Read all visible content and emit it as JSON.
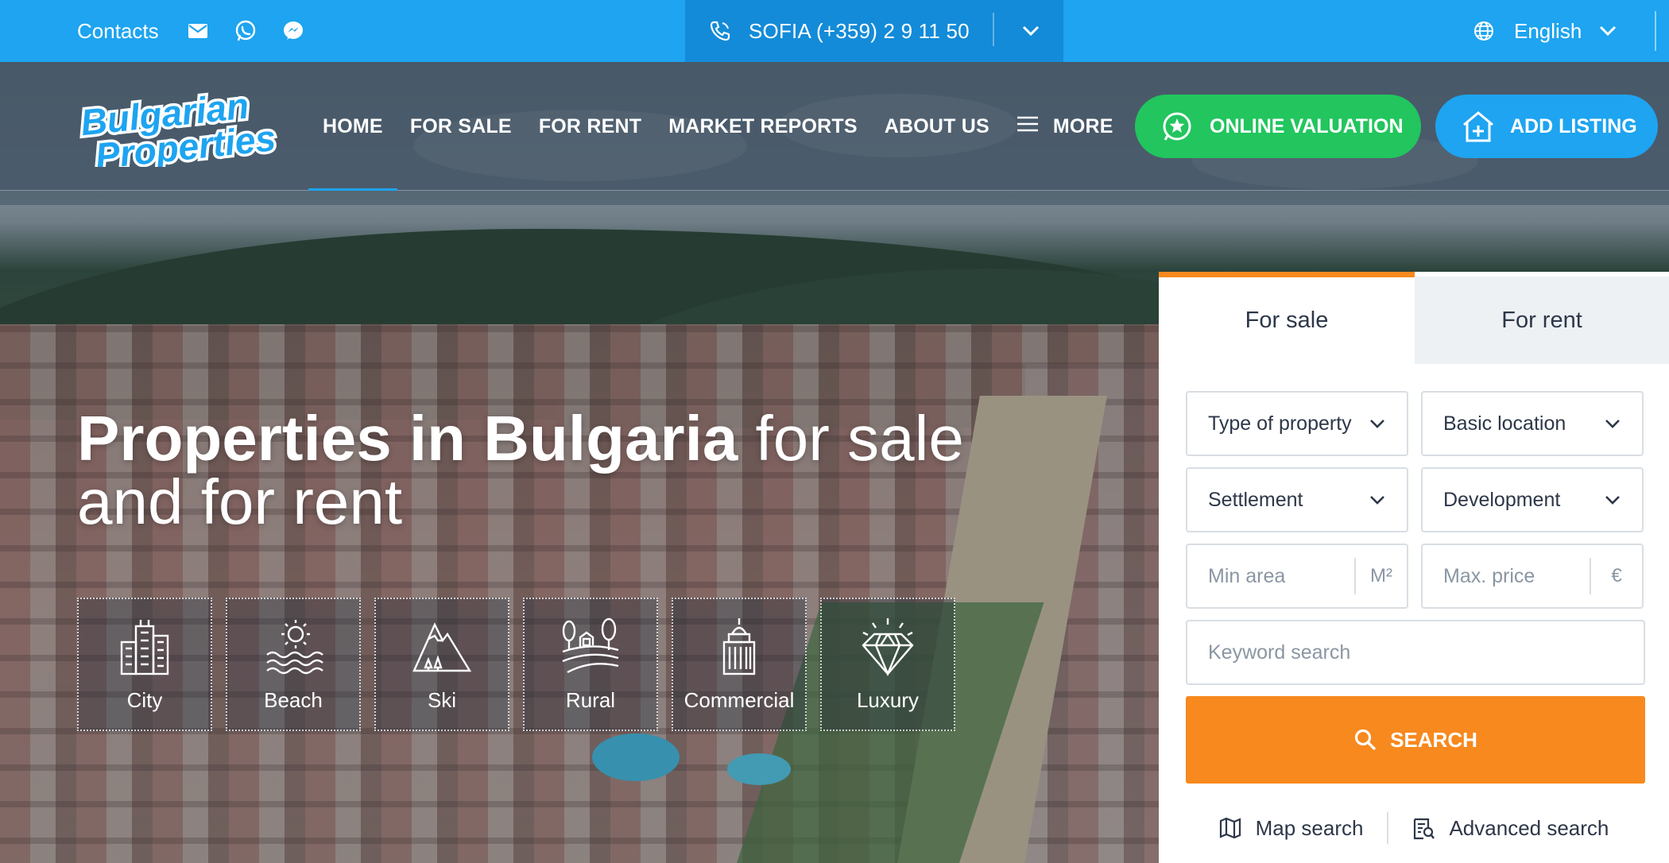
{
  "topbar": {
    "contacts_label": "Contacts",
    "phone": "SOFIA (+359) 2 9 11 50",
    "language": "English",
    "icons": [
      "mail-icon",
      "whatsapp-icon",
      "messenger-icon",
      "phone-icon",
      "chevron-down-icon",
      "globe-icon"
    ]
  },
  "brand": {
    "logo_line1": "Bulgarian",
    "logo_line2": "Properties"
  },
  "nav": {
    "items": [
      "HOME",
      "FOR SALE",
      "FOR RENT",
      "MARKET REPORTS",
      "ABOUT US"
    ],
    "more": "MORE",
    "active": "HOME"
  },
  "actions": {
    "valuation": "ONLINE VALUATION",
    "add_listing": "ADD LISTING"
  },
  "hero": {
    "headline_bold": "Properties in Bulgaria",
    "headline_light1": " for sale",
    "headline_light2": "and for rent",
    "categories": [
      "City",
      "Beach",
      "Ski",
      "Rural",
      "Commercial",
      "Luxury"
    ]
  },
  "search": {
    "tabs": [
      "For sale",
      "For rent"
    ],
    "active_tab": "For sale",
    "type_of_property": "Type of property",
    "basic_location": "Basic location",
    "settlement": "Settlement",
    "development": "Development",
    "min_area_placeholder": "Min area",
    "area_unit": "M²",
    "max_price_placeholder": "Max. price",
    "price_unit": "€",
    "keyword_placeholder": "Keyword search",
    "search_button": "SEARCH",
    "map_search": "Map search",
    "advanced_search": "Advanced search"
  },
  "colors": {
    "topbar": "#1ea4f0",
    "phone_block": "#148bd8",
    "valuation_green": "#22c55e",
    "accent_orange": "#f7891e"
  }
}
